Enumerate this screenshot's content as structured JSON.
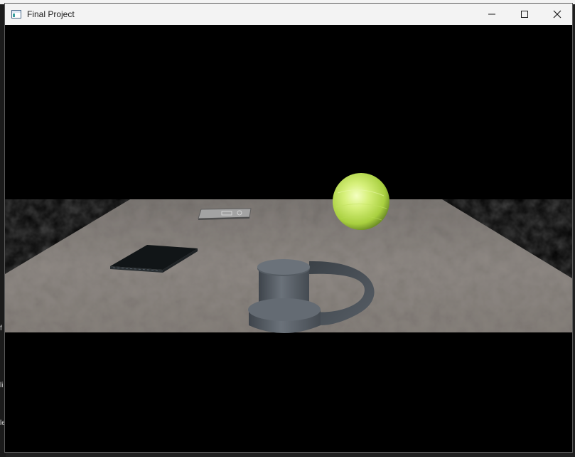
{
  "window": {
    "title": "Final Project",
    "icon": "app-window-icon",
    "buttons": {
      "minimize": "minimize-icon",
      "maximize": "maximize-icon",
      "close": "close-icon"
    }
  },
  "background_fragments": [
    "f",
    "li",
    "le"
  ],
  "scene": {
    "background_color": "#000000",
    "plane_color": "#8f8984",
    "sphere_color": "#d6f07a",
    "mug_color": "#5b626b",
    "book_color": "#111517",
    "remote_color": "#9a9a9a"
  }
}
